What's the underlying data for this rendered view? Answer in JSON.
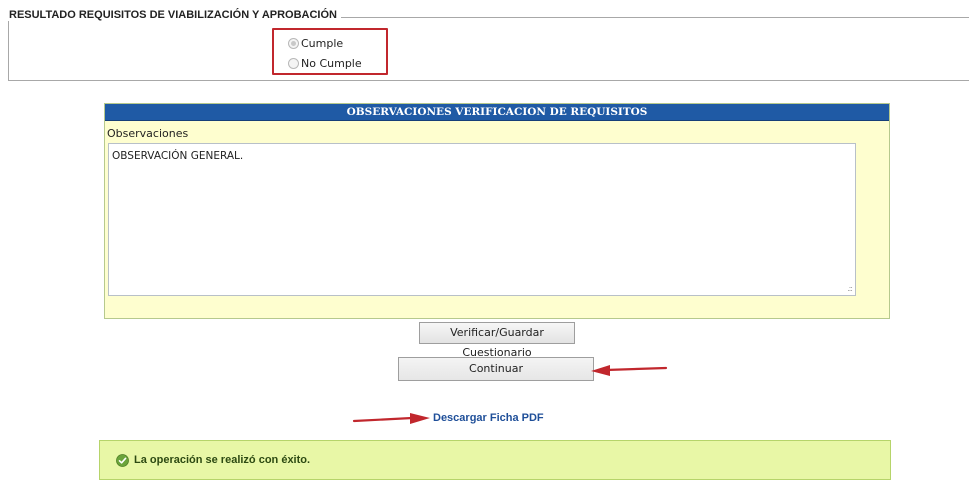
{
  "result_section": {
    "legend": "RESULTADO REQUISITOS DE VIABILIZACIÓN Y APROBACIÓN",
    "options": [
      {
        "label": "Cumple",
        "selected": true
      },
      {
        "label": "No Cumple",
        "selected": false
      }
    ]
  },
  "observations_panel": {
    "header": "OBSERVACIONES VERIFICACION DE REQUISITOS",
    "label": "Observaciones",
    "value": "OBSERVACIÓN GENERAL."
  },
  "actions": {
    "verify_label": "Verificar/Guardar Cuestionario",
    "continue_label": "Continuar",
    "download_label": "Descargar Ficha PDF"
  },
  "status": {
    "message": "La operación se realizó con éxito."
  },
  "colors": {
    "header_bg": "#1f5aa5",
    "panel_bg": "#fefecf",
    "highlight_border": "#c1272d",
    "success_bg": "#e8f7a6",
    "arrow": "#c1272d"
  }
}
